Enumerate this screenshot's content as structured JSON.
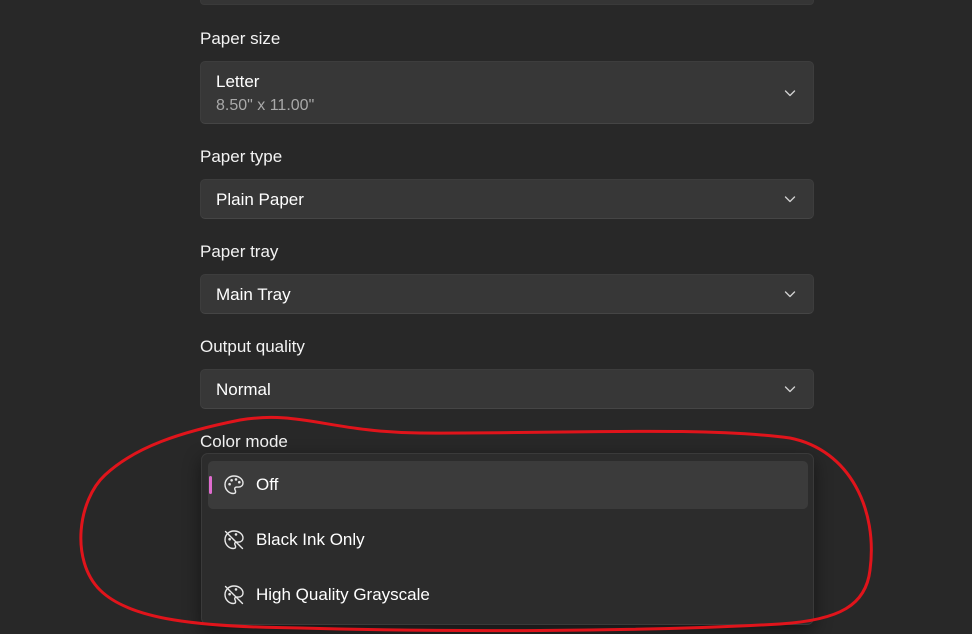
{
  "fields": {
    "paper_size": {
      "label": "Paper size",
      "value": "Letter",
      "detail": "8.50\" x 11.00\""
    },
    "paper_type": {
      "label": "Paper type",
      "value": "Plain Paper"
    },
    "paper_tray": {
      "label": "Paper tray",
      "value": "Main Tray"
    },
    "output_quality": {
      "label": "Output quality",
      "value": "Normal"
    },
    "color_mode": {
      "label": "Color mode",
      "options": [
        {
          "label": "Off",
          "icon": "palette-icon",
          "selected": true
        },
        {
          "label": "Black Ink Only",
          "icon": "palette-off-icon",
          "selected": false
        },
        {
          "label": "High Quality Grayscale",
          "icon": "palette-off-icon",
          "selected": false
        }
      ]
    }
  },
  "colors": {
    "background": "#282828",
    "control": "#373737",
    "accent": "#e06ccf",
    "annotation": "#e0141b"
  }
}
